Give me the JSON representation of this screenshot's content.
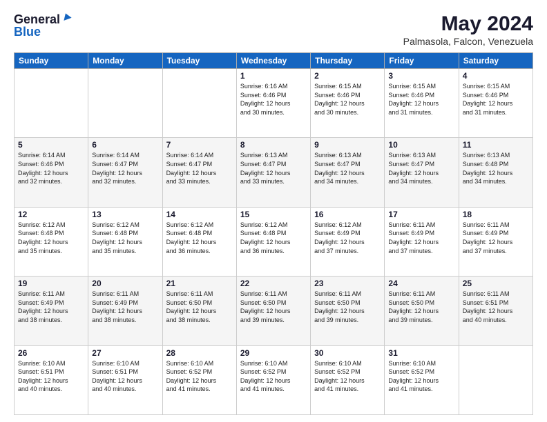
{
  "logo": {
    "general": "General",
    "blue": "Blue"
  },
  "title": "May 2024",
  "location": "Palmasola, Falcon, Venezuela",
  "weekdays": [
    "Sunday",
    "Monday",
    "Tuesday",
    "Wednesday",
    "Thursday",
    "Friday",
    "Saturday"
  ],
  "weeks": [
    [
      {
        "day": "",
        "info": ""
      },
      {
        "day": "",
        "info": ""
      },
      {
        "day": "",
        "info": ""
      },
      {
        "day": "1",
        "info": "Sunrise: 6:16 AM\nSunset: 6:46 PM\nDaylight: 12 hours\nand 30 minutes."
      },
      {
        "day": "2",
        "info": "Sunrise: 6:15 AM\nSunset: 6:46 PM\nDaylight: 12 hours\nand 30 minutes."
      },
      {
        "day": "3",
        "info": "Sunrise: 6:15 AM\nSunset: 6:46 PM\nDaylight: 12 hours\nand 31 minutes."
      },
      {
        "day": "4",
        "info": "Sunrise: 6:15 AM\nSunset: 6:46 PM\nDaylight: 12 hours\nand 31 minutes."
      }
    ],
    [
      {
        "day": "5",
        "info": "Sunrise: 6:14 AM\nSunset: 6:46 PM\nDaylight: 12 hours\nand 32 minutes."
      },
      {
        "day": "6",
        "info": "Sunrise: 6:14 AM\nSunset: 6:47 PM\nDaylight: 12 hours\nand 32 minutes."
      },
      {
        "day": "7",
        "info": "Sunrise: 6:14 AM\nSunset: 6:47 PM\nDaylight: 12 hours\nand 33 minutes."
      },
      {
        "day": "8",
        "info": "Sunrise: 6:13 AM\nSunset: 6:47 PM\nDaylight: 12 hours\nand 33 minutes."
      },
      {
        "day": "9",
        "info": "Sunrise: 6:13 AM\nSunset: 6:47 PM\nDaylight: 12 hours\nand 34 minutes."
      },
      {
        "day": "10",
        "info": "Sunrise: 6:13 AM\nSunset: 6:47 PM\nDaylight: 12 hours\nand 34 minutes."
      },
      {
        "day": "11",
        "info": "Sunrise: 6:13 AM\nSunset: 6:48 PM\nDaylight: 12 hours\nand 34 minutes."
      }
    ],
    [
      {
        "day": "12",
        "info": "Sunrise: 6:12 AM\nSunset: 6:48 PM\nDaylight: 12 hours\nand 35 minutes."
      },
      {
        "day": "13",
        "info": "Sunrise: 6:12 AM\nSunset: 6:48 PM\nDaylight: 12 hours\nand 35 minutes."
      },
      {
        "day": "14",
        "info": "Sunrise: 6:12 AM\nSunset: 6:48 PM\nDaylight: 12 hours\nand 36 minutes."
      },
      {
        "day": "15",
        "info": "Sunrise: 6:12 AM\nSunset: 6:48 PM\nDaylight: 12 hours\nand 36 minutes."
      },
      {
        "day": "16",
        "info": "Sunrise: 6:12 AM\nSunset: 6:49 PM\nDaylight: 12 hours\nand 37 minutes."
      },
      {
        "day": "17",
        "info": "Sunrise: 6:11 AM\nSunset: 6:49 PM\nDaylight: 12 hours\nand 37 minutes."
      },
      {
        "day": "18",
        "info": "Sunrise: 6:11 AM\nSunset: 6:49 PM\nDaylight: 12 hours\nand 37 minutes."
      }
    ],
    [
      {
        "day": "19",
        "info": "Sunrise: 6:11 AM\nSunset: 6:49 PM\nDaylight: 12 hours\nand 38 minutes."
      },
      {
        "day": "20",
        "info": "Sunrise: 6:11 AM\nSunset: 6:49 PM\nDaylight: 12 hours\nand 38 minutes."
      },
      {
        "day": "21",
        "info": "Sunrise: 6:11 AM\nSunset: 6:50 PM\nDaylight: 12 hours\nand 38 minutes."
      },
      {
        "day": "22",
        "info": "Sunrise: 6:11 AM\nSunset: 6:50 PM\nDaylight: 12 hours\nand 39 minutes."
      },
      {
        "day": "23",
        "info": "Sunrise: 6:11 AM\nSunset: 6:50 PM\nDaylight: 12 hours\nand 39 minutes."
      },
      {
        "day": "24",
        "info": "Sunrise: 6:11 AM\nSunset: 6:50 PM\nDaylight: 12 hours\nand 39 minutes."
      },
      {
        "day": "25",
        "info": "Sunrise: 6:11 AM\nSunset: 6:51 PM\nDaylight: 12 hours\nand 40 minutes."
      }
    ],
    [
      {
        "day": "26",
        "info": "Sunrise: 6:10 AM\nSunset: 6:51 PM\nDaylight: 12 hours\nand 40 minutes."
      },
      {
        "day": "27",
        "info": "Sunrise: 6:10 AM\nSunset: 6:51 PM\nDaylight: 12 hours\nand 40 minutes."
      },
      {
        "day": "28",
        "info": "Sunrise: 6:10 AM\nSunset: 6:52 PM\nDaylight: 12 hours\nand 41 minutes."
      },
      {
        "day": "29",
        "info": "Sunrise: 6:10 AM\nSunset: 6:52 PM\nDaylight: 12 hours\nand 41 minutes."
      },
      {
        "day": "30",
        "info": "Sunrise: 6:10 AM\nSunset: 6:52 PM\nDaylight: 12 hours\nand 41 minutes."
      },
      {
        "day": "31",
        "info": "Sunrise: 6:10 AM\nSunset: 6:52 PM\nDaylight: 12 hours\nand 41 minutes."
      },
      {
        "day": "",
        "info": ""
      }
    ]
  ]
}
